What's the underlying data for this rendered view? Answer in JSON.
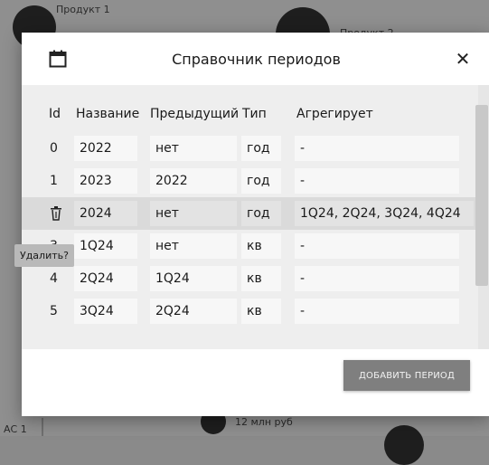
{
  "background": {
    "nodes": [
      {
        "label": "Продукт 1"
      },
      {
        "label": "Продукт 2"
      },
      {
        "label": "12 млн руб"
      },
      {
        "label": "АС 1"
      }
    ]
  },
  "dialog": {
    "title": "Справочник периодов",
    "icon": "calendar-icon",
    "close_label": "✕",
    "columns": [
      "Id",
      "Название",
      "Предыдущий",
      "Тип",
      "Агрегирует"
    ],
    "rows": [
      {
        "id": "0",
        "name": "2022",
        "prev": "нет",
        "type": "год",
        "aggr": "-"
      },
      {
        "id": "1",
        "name": "2023",
        "prev": "2022",
        "type": "год",
        "aggr": "-"
      },
      {
        "id": "2",
        "name": "2024",
        "prev": "нет",
        "type": "год",
        "aggr": "1Q24, 2Q24, 3Q24, 4Q24"
      },
      {
        "id": "3",
        "name": "1Q24",
        "prev": "нет",
        "type": "кв",
        "aggr": "-"
      },
      {
        "id": "4",
        "name": "2Q24",
        "prev": "1Q24",
        "type": "кв",
        "aggr": "-"
      },
      {
        "id": "5",
        "name": "3Q24",
        "prev": "2Q24",
        "type": "кв",
        "aggr": "-"
      }
    ],
    "add_button": "ДОБАВИТЬ ПЕРИОД",
    "tooltip": "Удалить?"
  },
  "colors": {
    "overlay": "#8f8f8f",
    "table_bg": "#eeeeee",
    "selected_row": "#dadada",
    "button_bg": "#7f7f7f"
  }
}
